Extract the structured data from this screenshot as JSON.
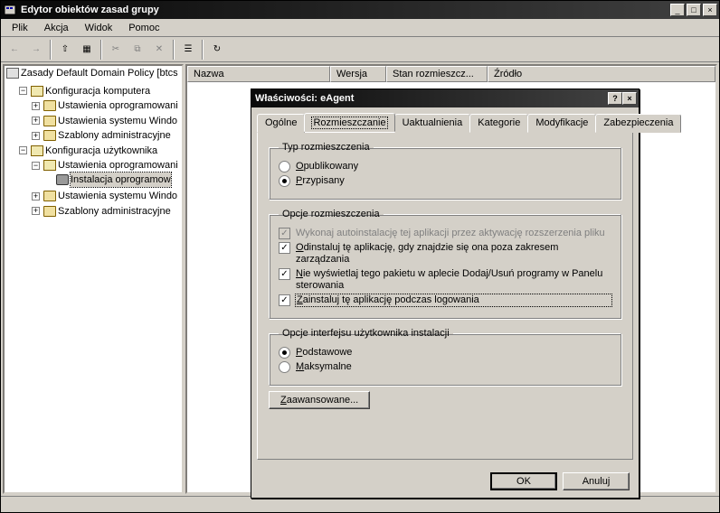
{
  "window": {
    "title": "Edytor obiektów zasad grupy"
  },
  "menu": {
    "items": [
      "Plik",
      "Akcja",
      "Widok",
      "Pomoc"
    ]
  },
  "list": {
    "cols": [
      "Nazwa",
      "Wersja",
      "Stan rozmieszcz...",
      "Źródło"
    ]
  },
  "tree": {
    "root": "Zasady Default Domain Policy [btcs",
    "computer": {
      "label": "Konfiguracja komputera",
      "children": [
        "Ustawienia oprogramowani",
        "Ustawienia systemu Windo",
        "Szablony administracyjne"
      ]
    },
    "user": {
      "label": "Konfiguracja użytkownika",
      "software": "Ustawienia oprogramowani",
      "install": "Instalacja oprogramow",
      "sys": "Ustawienia systemu Windo",
      "templates": "Szablony administracyjne"
    }
  },
  "dialog": {
    "title": "Właściwości: eAgent",
    "tabs": [
      "Ogólne",
      "Rozmieszczanie",
      "Uaktualnienia",
      "Kategorie",
      "Modyfikacje",
      "Zabezpieczenia"
    ],
    "activeTab": 1,
    "group1": {
      "legend": "Typ rozmieszczenia",
      "opt_published": "Opublikowany",
      "opt_assigned": "Przypisany"
    },
    "group2": {
      "legend": "Opcje rozmieszczenia",
      "c1": "Wykonaj autoinstalację tej aplikacji przez aktywację rozszerzenia pliku",
      "c2": "Odinstaluj tę aplikację, gdy znajdzie się ona poza zakresem zarządzania",
      "c3": "Nie wyświetlaj tego pakietu w aplecie Dodaj/Usuń programy w Panelu sterowania",
      "c4": "Zainstaluj tę aplikację podczas logowania"
    },
    "group3": {
      "legend": "Opcje interfejsu użytkownika instalacji",
      "r1": "Podstawowe",
      "r2": "Maksymalne"
    },
    "advanced": "Zaawansowane...",
    "ok": "OK",
    "cancel": "Anuluj"
  }
}
